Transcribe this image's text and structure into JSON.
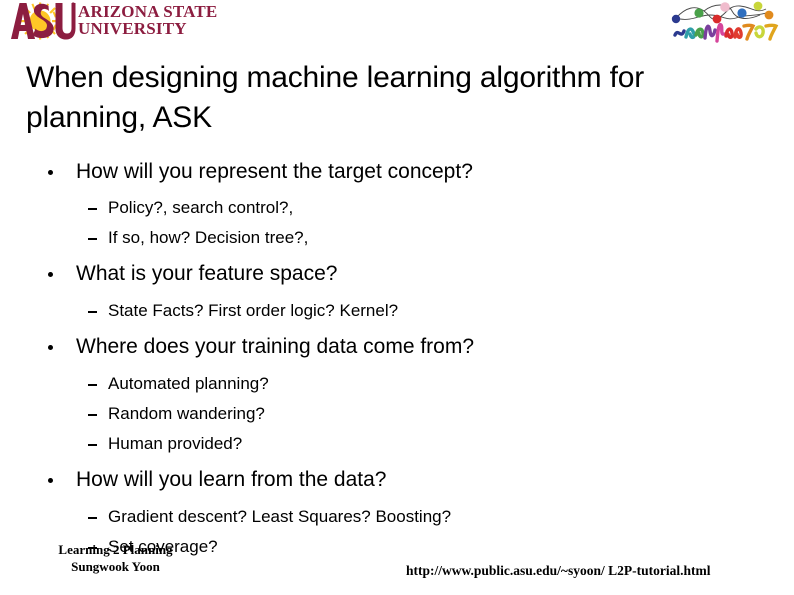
{
  "header": {
    "asu_logo": {
      "mark_icon": "asu-pitchfork-sunburst-icon",
      "line1": "ARIZONA STATE",
      "line2": "UNIVERSITY",
      "maroon": "#8C1D40",
      "gold": "#FFC627"
    },
    "icaps_logo": {
      "icon": "icaps-2007-conference-logo-icon",
      "label": "icaps07"
    }
  },
  "title": "When designing machine learning algorithm for planning, ASK",
  "bullets": [
    {
      "level": 1,
      "text": "How will you represent the target concept?"
    },
    {
      "level": 2,
      "text": "Policy?, search control?,"
    },
    {
      "level": 2,
      "text": "If so, how? Decision tree?,"
    },
    {
      "level": 1,
      "text": "What is your feature space?"
    },
    {
      "level": 2,
      "text": "State Facts? First order logic? Kernel?"
    },
    {
      "level": 1,
      "text": "Where does your training data come from?"
    },
    {
      "level": 2,
      "text": "Automated planning?"
    },
    {
      "level": 2,
      "text": "Random wandering?"
    },
    {
      "level": 2,
      "text": "Human provided?"
    },
    {
      "level": 1,
      "text": "How will you learn from the data?"
    },
    {
      "level": 2,
      "text": "Gradient descent? Least Squares? Boosting?"
    },
    {
      "level": 2,
      "text": "Set coverage?"
    }
  ],
  "footer": {
    "left_line1": "Learning 2 Planning",
    "left_line2": "Sungwook Yoon",
    "right": "http://www.public.asu.edu/~syoon/ L2P-tutorial.html"
  }
}
